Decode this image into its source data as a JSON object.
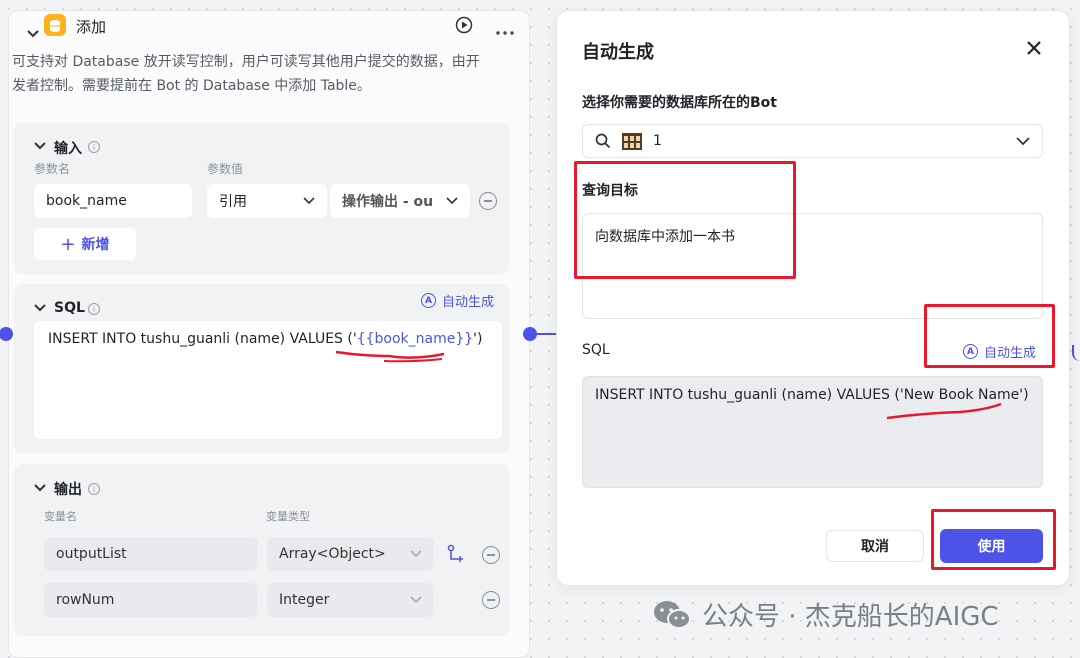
{
  "node": {
    "title": "添加",
    "description_line1": "可支持对 Database 放开读写控制，用户可读写其他用户提交的数据，由开",
    "description_line2": "发者控制。需要提前在 Bot 的 Database 中添加 Table。",
    "input": {
      "title": "输入",
      "col_name": "参数名",
      "col_value": "参数值",
      "param_name": "book_name",
      "ref_select": "引用",
      "output_select": "操作输出 - ou",
      "add_label": "新增"
    },
    "sql": {
      "title": "SQL",
      "auto_gen": "自动生成",
      "query_prefix": "INSERT INTO tushu_guanli (name) VALUES ('",
      "query_var": "{{book_name}}",
      "query_suffix": "')"
    },
    "output": {
      "title": "输出",
      "col_name": "变量名",
      "col_type": "变量类型",
      "rows": [
        {
          "name": "outputList",
          "type": "Array<Object>"
        },
        {
          "name": "rowNum",
          "type": "Integer"
        }
      ]
    }
  },
  "panel": {
    "title": "自动生成",
    "db_label": "选择你需要的数据库所在的Bot",
    "db_value": "1",
    "goal_label": "查询目标",
    "goal_text": "向数据库中添加一本书",
    "sql_label": "SQL",
    "auto_gen": "自动生成",
    "sql_text": "INSERT INTO tushu_guanli (name) VALUES ('New Book Name')",
    "cancel": "取消",
    "use": "使用"
  },
  "watermark": "公众号 · 杰克船长的AIGC",
  "colors": {
    "accent": "#4d53e8",
    "annotation": "#e8192c",
    "db_icon": "#ffb020"
  }
}
